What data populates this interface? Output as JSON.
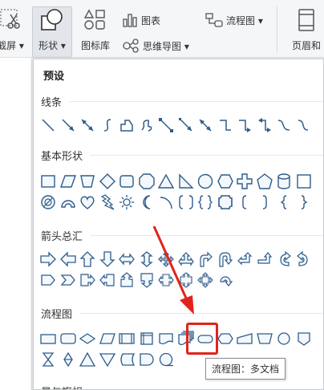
{
  "ribbon": {
    "screenshot_label": "截屏",
    "shape_label": "形状",
    "iconlib_label": "图标库",
    "chart_label": "图表",
    "mindmap_label": "思维导图",
    "flowchart_label": "流程图",
    "header_footer_label": "页眉和"
  },
  "panel": {
    "preset_title": "预设",
    "sections": {
      "lines": "线条",
      "basic": "基本形状",
      "arrows": "箭头总汇",
      "flowchart": "流程图",
      "stars": "星与旗帜"
    }
  },
  "tooltip": "流程图：多文档",
  "colors": {
    "accent_red": "#e0241b",
    "shape_stroke": "#2d5c8a",
    "shape_fill": "#f4f8fc"
  }
}
